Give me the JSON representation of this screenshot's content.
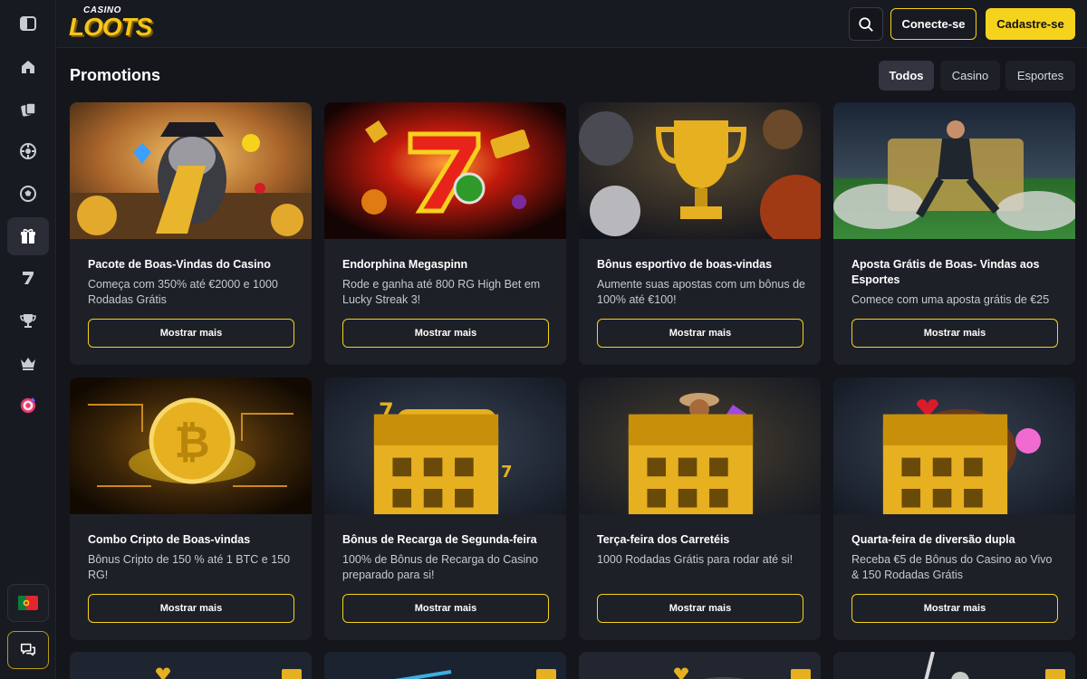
{
  "brand": {
    "top": "CASINO",
    "main": "LOOTS"
  },
  "header": {
    "login_label": "Conecte-se",
    "signup_label": "Cadastre-se"
  },
  "page": {
    "title": "Promotions"
  },
  "filters": [
    "Todos",
    "Casino",
    "Esportes"
  ],
  "locale": {
    "flag": "PT"
  },
  "colors": {
    "accent": "#f5d21c",
    "bg": "#14161c",
    "card": "#1e2028"
  },
  "promotions": [
    {
      "title": "Pacote de Boas-Vindas do Casino",
      "desc": "Começa com 350% até €2000 e 1000 Rodadas Grátis",
      "button": "Mostrar mais"
    },
    {
      "title": "Endorphina Megaspinn",
      "desc": "Rode e ganha até 800 RG High Bet em Lucky Streak 3!",
      "button": "Mostrar mais"
    },
    {
      "title": "Bônus esportivo de boas-vindas",
      "desc": "Aumente suas apostas com um bônus de 100% até €100!",
      "button": "Mostrar mais"
    },
    {
      "title": "Aposta Grátis de Boas- Vindas aos Esportes",
      "desc": "Comece com uma aposta grátis de €25",
      "button": "Mostrar mais"
    },
    {
      "title": "Combo Cripto de Boas-vindas",
      "desc": "Bônus Cripto de 150 % até 1 BTC e 150 RG!",
      "button": "Mostrar mais"
    },
    {
      "title": "Bônus de Recarga de Segunda-feira",
      "desc": "100% de Bônus de Recarga do Casino preparado para si!",
      "button": "Mostrar mais"
    },
    {
      "title": "Terça-feira dos Carretéis",
      "desc": "1000 Rodadas Grátis para rodar até si!",
      "button": "Mostrar mais"
    },
    {
      "title": "Quarta-feira de diversão dupla",
      "desc": "Receba €5 de Bônus do Casino ao Vivo & 150 Rodadas Grátis",
      "button": "Mostrar mais"
    }
  ]
}
